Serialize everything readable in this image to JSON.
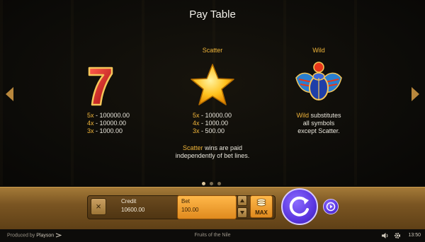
{
  "title": "Pay Table",
  "columns": {
    "seven": {
      "symbol": "seven-symbol",
      "payouts": [
        {
          "mult": "5x",
          "value": "100000.00"
        },
        {
          "mult": "4x",
          "value": "10000.00"
        },
        {
          "mult": "3x",
          "value": "1000.00"
        }
      ]
    },
    "scatter": {
      "header": "Scatter",
      "symbol": "star-symbol",
      "payouts": [
        {
          "mult": "5x",
          "value": "10000.00"
        },
        {
          "mult": "4x",
          "value": "1000.00"
        },
        {
          "mult": "3x",
          "value": "500.00"
        }
      ]
    },
    "wild": {
      "header": "Wild",
      "symbol": "scarab-symbol",
      "desc_word": "Wild",
      "desc_rest_1": " substitutes",
      "desc_line_2": "all symbols",
      "desc_line_3": "except Scatter."
    }
  },
  "scatter_note": {
    "word": "Scatter",
    "rest_1": " wins are paid",
    "line_2": "independently of bet lines."
  },
  "pagination": {
    "pages": 3,
    "current": 1
  },
  "controls": {
    "close_symbol": "×",
    "credit_label": "Credit",
    "credit_value": "10600.00",
    "bet_label": "Bet",
    "bet_value": "100.00",
    "max_label": "MAX"
  },
  "footer": {
    "produced_by": "Produced by",
    "brand": "Playson",
    "game_name": "Fruits of the Nile",
    "time": "13:50"
  },
  "colors": {
    "accent": "#f0b53a",
    "spin": "#5a36e0",
    "bar": "#7a5522"
  }
}
